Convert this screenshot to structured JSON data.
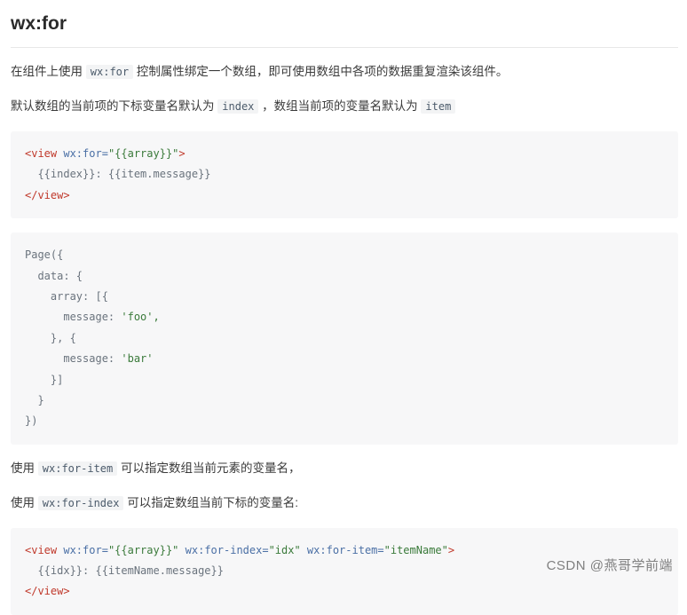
{
  "page": {
    "title": "wx:for",
    "paragraphs": {
      "p1_a": "在组件上使用",
      "p1_code": "wx:for",
      "p1_b": "控制属性绑定一个数组，即可使用数组中各项的数据重复渲染该组件。",
      "p2_a": "默认数组的当前项的下标变量名默认为",
      "p2_code1": "index",
      "p2_b": "，数组当前项的变量名默认为",
      "p2_code2": "item",
      "p3_a": "使用",
      "p3_code": "wx:for-item",
      "p3_b": "可以指定数组当前元素的变量名，",
      "p4_a": "使用",
      "p4_code": "wx:for-index",
      "p4_b": "可以指定数组当前下标的变量名:"
    },
    "code_block_1": {
      "line1_tag_open": "<view ",
      "line1_attr": "wx:for=",
      "line1_val": "\"{{array}}\"",
      "line1_tag_close": ">",
      "line2": "  {{index}}: {{item.message}}",
      "line3": "</view>"
    },
    "code_block_2": {
      "l1": "Page({",
      "l2": "  data: {",
      "l3": "    array: [{",
      "l4_key": "      message: ",
      "l4_val": "'foo',",
      "l5": "    }, {",
      "l6_key": "      message: ",
      "l6_val": "'bar'",
      "l7": "    }]",
      "l8": "  }",
      "l9": "})"
    },
    "code_block_3": {
      "line1_tag_open": "<view ",
      "line1_attr1": "wx:for=",
      "line1_val1": "\"{{array}}\"",
      "line1_attr2": " wx:for-index=",
      "line1_val2": "\"idx\"",
      "line1_attr3": " wx:for-item=",
      "line1_val3": "\"itemName\"",
      "line1_tag_close": ">",
      "line2": "  {{idx}}: {{itemName.message}}",
      "line3": "</view>"
    },
    "watermark": "CSDN @燕哥学前端"
  }
}
